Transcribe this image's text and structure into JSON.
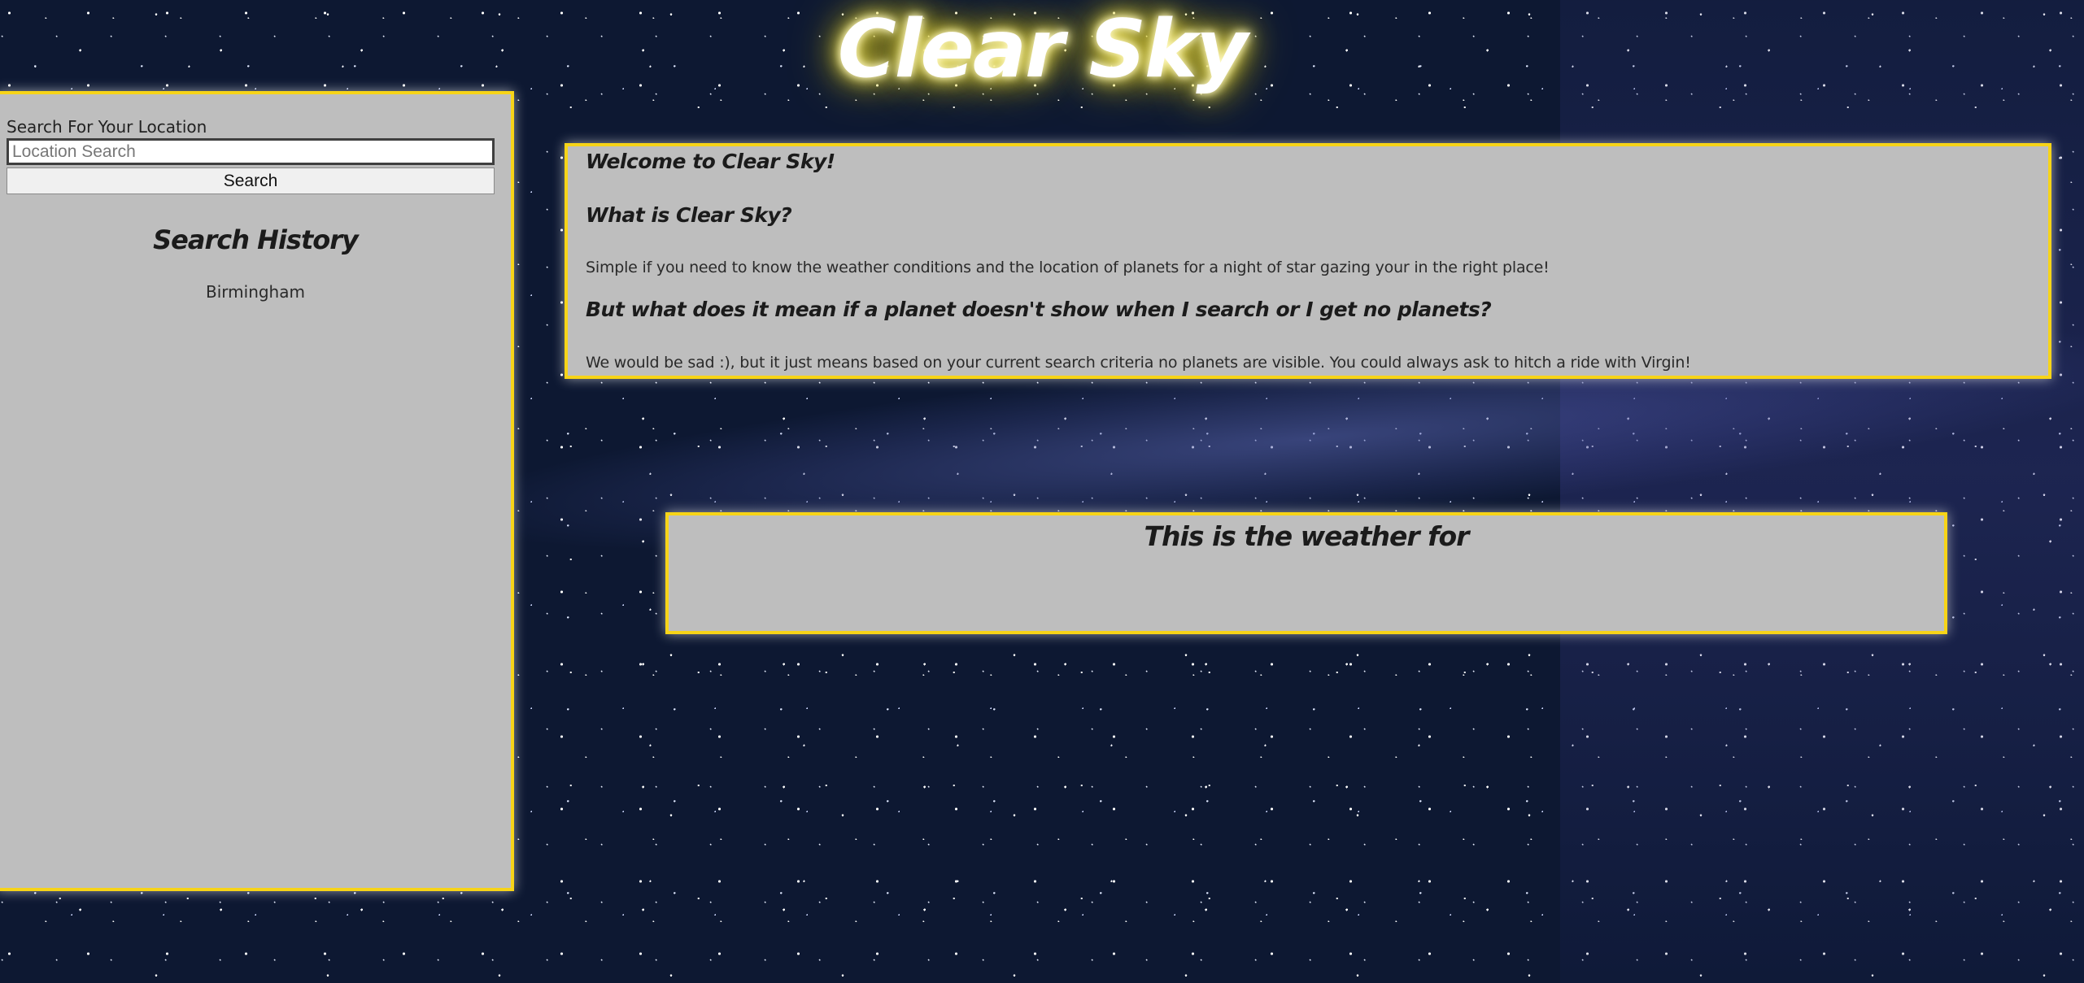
{
  "app": {
    "title": "Clear Sky"
  },
  "colors": {
    "panel_background": "#bebebe",
    "panel_border": "#f7d418",
    "title_glow": "#ecd81e",
    "page_background": "#0d1832"
  },
  "sidebar": {
    "search_label": "Search For Your Location",
    "search_placeholder": "Location Search",
    "search_value": "",
    "search_button_label": "Search",
    "history_title": "Search History",
    "history_items": [
      "Birmingham"
    ]
  },
  "welcome": {
    "heading_1": "Welcome to Clear Sky!",
    "heading_2": "What is Clear Sky?",
    "text_1": "Simple if you need to know the weather conditions and the location of planets for a night of star gazing your in the right place!",
    "heading_3": "But what does it mean if a planet doesn't show when I search or I get no planets?",
    "text_2": "We would be sad :), but it just means based on your current search criteria no planets are visible. You could always ask to hitch a ride with Virgin!"
  },
  "weather": {
    "title": "This is the weather for"
  }
}
